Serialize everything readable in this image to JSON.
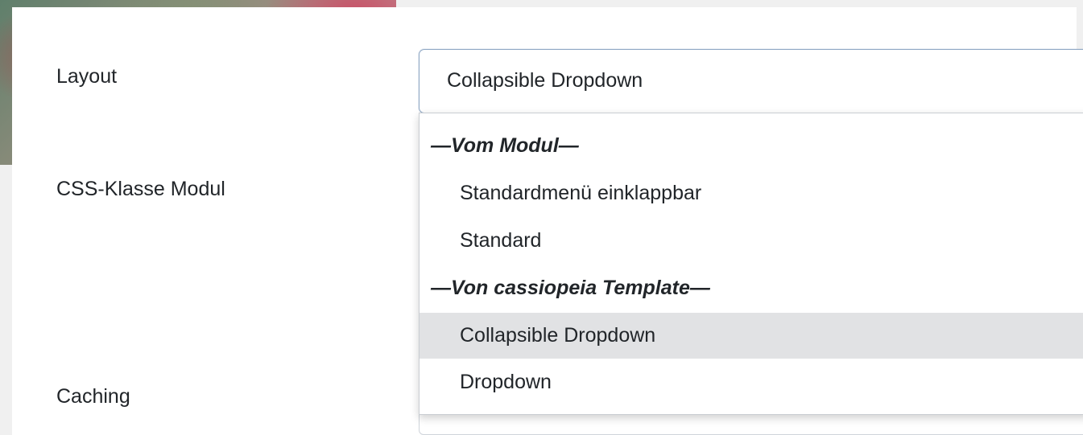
{
  "form": {
    "layout_label": "Layout",
    "css_class_label": "CSS-Klasse Modul",
    "caching_label": "Caching"
  },
  "layout_select": {
    "value": "Collapsible Dropdown",
    "options": [
      {
        "type": "group",
        "label": "—Vom Modul—"
      },
      {
        "type": "option",
        "label": "Standardmenü einklappbar"
      },
      {
        "type": "option",
        "label": "Standard"
      },
      {
        "type": "group",
        "label": "—Von cassiopeia Template—"
      },
      {
        "type": "option",
        "label": "Collapsible Dropdown",
        "selected": true
      },
      {
        "type": "option",
        "label": "Dropdown"
      }
    ]
  },
  "colors": {
    "selected_option_bg": "#e1e2e4",
    "focus_border": "#8fa8c4",
    "text": "#212529"
  }
}
